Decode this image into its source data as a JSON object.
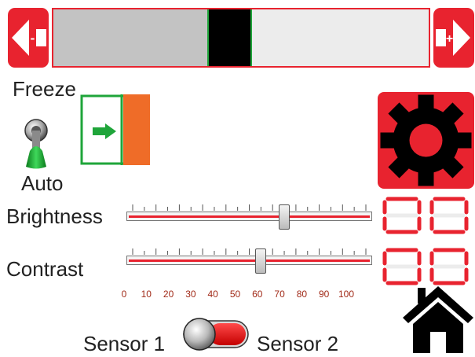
{
  "range": {
    "fill_percent": 41,
    "marker_start_percent": 41,
    "marker_end_percent": 52
  },
  "nav": {
    "decrease_symbol": "-",
    "increase_symbol": "+"
  },
  "mode": {
    "freeze_label": "Freeze",
    "auto_label": "Auto"
  },
  "brightness": {
    "label": "Brightness",
    "value": 65,
    "display": [
      "0",
      "0"
    ]
  },
  "contrast": {
    "label": "Contrast",
    "value": 55,
    "display": [
      "0",
      "0"
    ]
  },
  "scale_labels": [
    "0",
    "10",
    "20",
    "30",
    "40",
    "50",
    "60",
    "70",
    "80",
    "90",
    "100"
  ],
  "sensor": {
    "left_label": "Sensor 1",
    "right_label": "Sensor 2",
    "selected": "Sensor 2"
  },
  "icons": [
    "arrow-left-minus-icon",
    "arrow-right-plus-icon",
    "toggle-switch-icon",
    "arrow-right-icon",
    "gear-icon",
    "home-icon"
  ],
  "colors": {
    "accent": "#e8232f",
    "green": "#1fa53a",
    "orange": "#ef6c28",
    "scale_text": "#a12a18"
  }
}
